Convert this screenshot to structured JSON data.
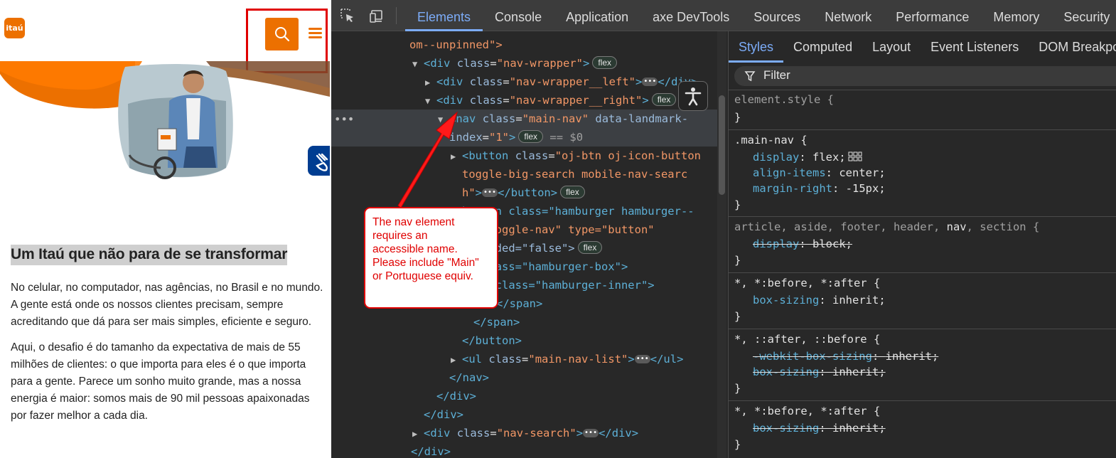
{
  "site": {
    "logo_text": "itaú",
    "heading": "Um Itaú que não para de se transformar",
    "paragraphs": [
      "No celular, no computador, nas agências, no Brasil e no mundo. A gente está onde os nossos clientes precisam, sempre acreditando que dá para ser mais simples, eficiente e seguro.",
      "Aqui, o desafio é do tamanho da expectativa de mais de 55 milhões de clientes: o que importa para eles é o que importa para a gente. Parece um sonho muito grande, mas a nossa energia é maior: somos mais de 90 mil pessoas apaixonadas por fazer melhor a cada dia."
    ],
    "brand_color": "#ec7000",
    "accessibility_color": "#003d91"
  },
  "devtools": {
    "main_tabs": [
      "Elements",
      "Console",
      "Application",
      "axe DevTools",
      "Sources",
      "Network",
      "Performance",
      "Memory",
      "Security"
    ],
    "active_tab": "Elements",
    "tree": {
      "l0": "om--unpinned\">",
      "l1_tag": "div",
      "l1_attr": "class",
      "l1_val": "\"nav-wrapper\"",
      "l2_tag": "div",
      "l2_attr": "class",
      "l2_val": "\"nav-wrapper__left\"",
      "l2_close": "</div>",
      "l3_tag": "div",
      "l3_attr": "class",
      "l3_val": "\"nav-wrapper__right\"",
      "l4_tag": "nav",
      "l4_attr": "class",
      "l4_val": "\"main-nav\"",
      "l4_attr2": "data-landmark-",
      "l5_attr": "index",
      "l5_val": "\"1\"",
      "l5_eq": "== $0",
      "l6_tag": "button",
      "l6_attr": "class",
      "l6_val": "\"oj-btn oj-icon-button",
      "l7": "toggle-big-search mobile-nav-searc",
      "l8": "h\"",
      "l8_close": "</button>",
      "l9": "button class=\"hamburger hamburger--",
      "l10": "ose toggle-nav\" type=\"button\"",
      "l11": "expanded=\"false\">",
      "l12": "an class=\"hamburger-box\">",
      "l13": "span class=\"hamburger-inner\">",
      "l14": "</span>",
      "l15": "</span>",
      "l16": "</button>",
      "l17_tag": "ul",
      "l17_attr": "class",
      "l17_val": "\"main-nav-list\"",
      "l17_close": "</ul>",
      "l18": "</nav>",
      "l19": "</div>",
      "l20": "</div>",
      "l21_tag": "div",
      "l21_attr": "class",
      "l21_val": "\"nav-search\"",
      "l21_close": "</div>",
      "l22": "</div>",
      "badge": "flex"
    },
    "styles_tabs": [
      "Styles",
      "Computed",
      "Layout",
      "Event Listeners",
      "DOM Breakpo"
    ],
    "filter_label": "Filter",
    "rules": {
      "r1_sel": "element.style {",
      "close": "}",
      "r2_sel": ".main-nav {",
      "r2_p1": "display",
      "r2_v1": "flex;",
      "r2_p2": "align-items",
      "r2_v2": "center;",
      "r2_p3": "margin-right",
      "r2_v3": "-15px;",
      "r3_sel_a": "article, aside, footer, header, ",
      "r3_sel_b": "nav",
      "r3_sel_c": ", section {",
      "r3_p1": "display",
      "r3_v1": "block;",
      "r4_sel": "*, *:before, *:after {",
      "r4_p1": "box-sizing",
      "r4_v1": "inherit;",
      "r5_sel": "*, ::after, ::before {",
      "r5_p1": "-webkit-box-sizing",
      "r5_v1": "inherit;",
      "r5_p2": "box-sizing",
      "r5_v2": "inherit;",
      "r6_sel": "*, *:before, *:after {",
      "r6_p1": "box-sizing",
      "r6_v1": "inherit;"
    },
    "callout_lines": [
      "The nav element",
      "requires an",
      "accessible name.",
      "Please include \"Main\"",
      "or Portuguese equiv."
    ]
  }
}
